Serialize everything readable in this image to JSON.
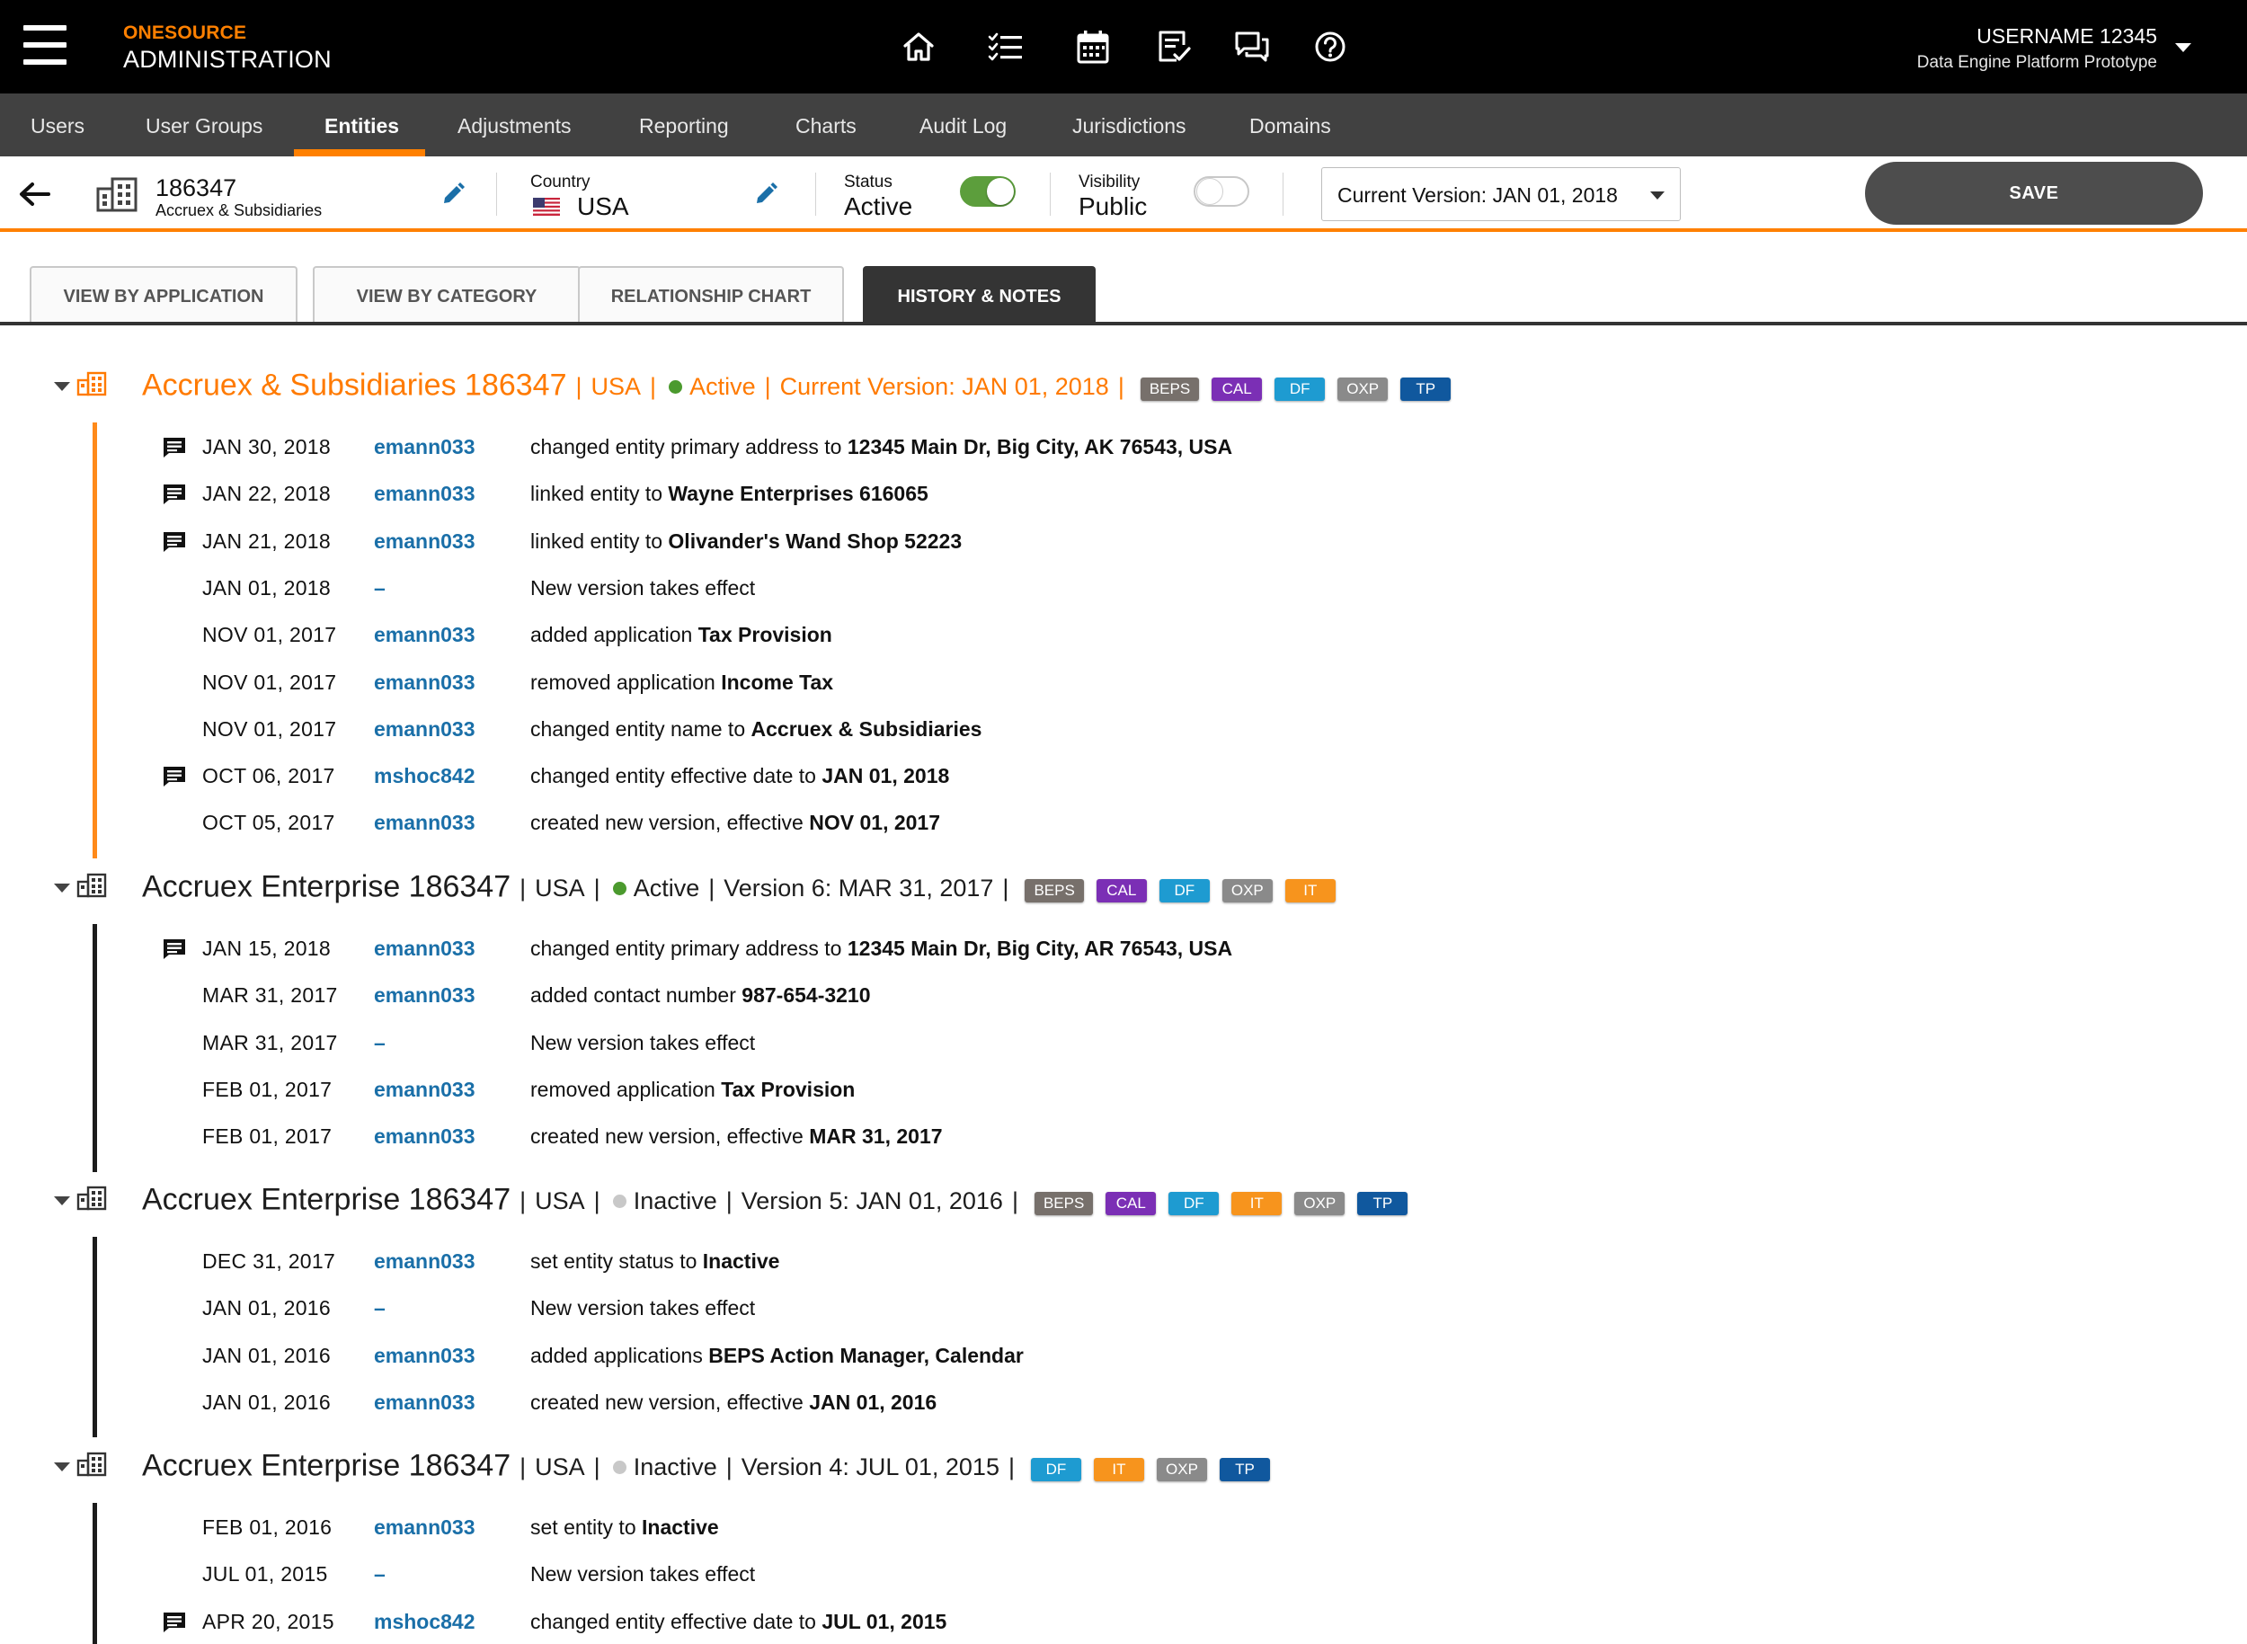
{
  "app": {
    "brand_top": "ONESOURCE",
    "brand_bottom": "ADMINISTRATION",
    "user_name": "USERNAME 12345",
    "user_sub": "Data Engine Platform Prototype",
    "top_icons": [
      "home-icon",
      "checklist-icon",
      "calendar-icon",
      "task-check-icon",
      "chat-icon",
      "help-icon"
    ]
  },
  "nav": {
    "items": [
      "Users",
      "User Groups",
      "Entities",
      "Adjustments",
      "Reporting",
      "Charts",
      "Audit Log",
      "Jurisdictions",
      "Domains"
    ],
    "active": "Entities"
  },
  "entity": {
    "id": "186347",
    "name": "Accruex & Subsidiaries",
    "country_label": "Country",
    "country": "USA",
    "status_label": "Status",
    "status": "Active",
    "status_on": true,
    "visibility_label": "Visibility",
    "visibility": "Public",
    "visibility_on": false,
    "version_select": "Current Version: JAN 01, 2018",
    "save_label": "SAVE"
  },
  "tabs": [
    "VIEW BY APPLICATION",
    "VIEW BY CATEGORY",
    "RELATIONSHIP CHART",
    "HISTORY & NOTES"
  ],
  "active_tab": "HISTORY & NOTES",
  "badge_colors": {
    "BEPS": "#77706b",
    "CAL": "#7b2fb5",
    "DF": "#1e9bd1",
    "OXP": "#8a8a8a",
    "TP": "#10589e",
    "IT": "#f7941d"
  },
  "colors": {
    "accent": "#ff8000",
    "link": "#1a6fa8",
    "active_dot": "#4b9a2e",
    "inactive_dot": "#c8c8c8"
  },
  "groups": [
    {
      "current": true,
      "name": "Accruex & Subsidiaries 186347",
      "country": "USA",
      "status": "Active",
      "status_active": true,
      "version": "Current Version: JAN 01, 2018",
      "badges": [
        "BEPS",
        "CAL",
        "DF",
        "OXP",
        "TP"
      ],
      "entries": [
        {
          "note": true,
          "date": "JAN 30, 2018",
          "user": "emann033",
          "text": "changed entity primary address to ",
          "bold": "12345 Main Dr, Big City, AK 76543, USA"
        },
        {
          "note": true,
          "date": "JAN 22, 2018",
          "user": "emann033",
          "text": "linked entity to ",
          "bold": "Wayne Enterprises 616065"
        },
        {
          "note": true,
          "date": "JAN 21, 2018",
          "user": "emann033",
          "text": "linked entity to ",
          "bold": "Olivander's Wand Shop 52223"
        },
        {
          "note": false,
          "date": "JAN 01, 2018",
          "user": "–",
          "text": "New version takes effect",
          "bold": ""
        },
        {
          "note": false,
          "date": "NOV 01, 2017",
          "user": "emann033",
          "text": "added application ",
          "bold": "Tax Provision"
        },
        {
          "note": false,
          "date": "NOV 01, 2017",
          "user": "emann033",
          "text": "removed application ",
          "bold": "Income Tax"
        },
        {
          "note": false,
          "date": "NOV 01, 2017",
          "user": "emann033",
          "text": "changed entity name to ",
          "bold": "Accruex & Subsidiaries"
        },
        {
          "note": true,
          "date": "OCT 06, 2017",
          "user": "mshoc842",
          "text": "changed entity effective date to ",
          "bold": "JAN 01, 2018"
        },
        {
          "note": false,
          "date": "OCT 05, 2017",
          "user": "emann033",
          "text": "created new version, effective ",
          "bold": "NOV 01, 2017"
        }
      ]
    },
    {
      "current": false,
      "name": "Accruex Enterprise 186347",
      "country": "USA",
      "status": "Active",
      "status_active": true,
      "version": "Version 6: MAR 31, 2017",
      "badges": [
        "BEPS",
        "CAL",
        "DF",
        "OXP",
        "IT"
      ],
      "entries": [
        {
          "note": true,
          "date": "JAN 15, 2018",
          "user": "emann033",
          "text": "changed entity primary address to ",
          "bold": "12345 Main Dr, Big City, AR 76543, USA"
        },
        {
          "note": false,
          "date": "MAR 31, 2017",
          "user": "emann033",
          "text": "added contact number ",
          "bold": "987-654-3210"
        },
        {
          "note": false,
          "date": "MAR 31, 2017",
          "user": "–",
          "text": "New version takes effect",
          "bold": ""
        },
        {
          "note": false,
          "date": "FEB 01, 2017",
          "user": "emann033",
          "text": "removed application ",
          "bold": "Tax Provision"
        },
        {
          "note": false,
          "date": "FEB 01, 2017",
          "user": "emann033",
          "text": "created new version, effective ",
          "bold": "MAR 31, 2017"
        }
      ]
    },
    {
      "current": false,
      "name": "Accruex Enterprise 186347",
      "country": "USA",
      "status": "Inactive",
      "status_active": false,
      "version": "Version 5: JAN 01, 2016",
      "badges": [
        "BEPS",
        "CAL",
        "DF",
        "IT",
        "OXP",
        "TP"
      ],
      "entries": [
        {
          "note": false,
          "date": "DEC 31, 2017",
          "user": "emann033",
          "text": "set entity status to ",
          "bold": "Inactive"
        },
        {
          "note": false,
          "date": "JAN 01, 2016",
          "user": "–",
          "text": "New version takes effect",
          "bold": ""
        },
        {
          "note": false,
          "date": "JAN 01, 2016",
          "user": "emann033",
          "text": "added applications ",
          "bold": "BEPS Action Manager, Calendar"
        },
        {
          "note": false,
          "date": "JAN 01, 2016",
          "user": "emann033",
          "text": "created new version, effective ",
          "bold": "JAN 01, 2016"
        }
      ]
    },
    {
      "current": false,
      "name": "Accruex Enterprise 186347",
      "country": "USA",
      "status": "Inactive",
      "status_active": false,
      "version": "Version 4: JUL 01, 2015",
      "badges": [
        "DF",
        "IT",
        "OXP",
        "TP"
      ],
      "entries": [
        {
          "note": false,
          "date": "FEB 01, 2016",
          "user": "emann033",
          "text": "set entity to ",
          "bold": "Inactive"
        },
        {
          "note": false,
          "date": "JUL 01, 2015",
          "user": "–",
          "text": "New version takes effect",
          "bold": ""
        },
        {
          "note": true,
          "date": "APR 20, 2015",
          "user": "mshoc842",
          "text": "changed entity effective date to ",
          "bold": "JUL 01, 2015"
        }
      ]
    }
  ]
}
